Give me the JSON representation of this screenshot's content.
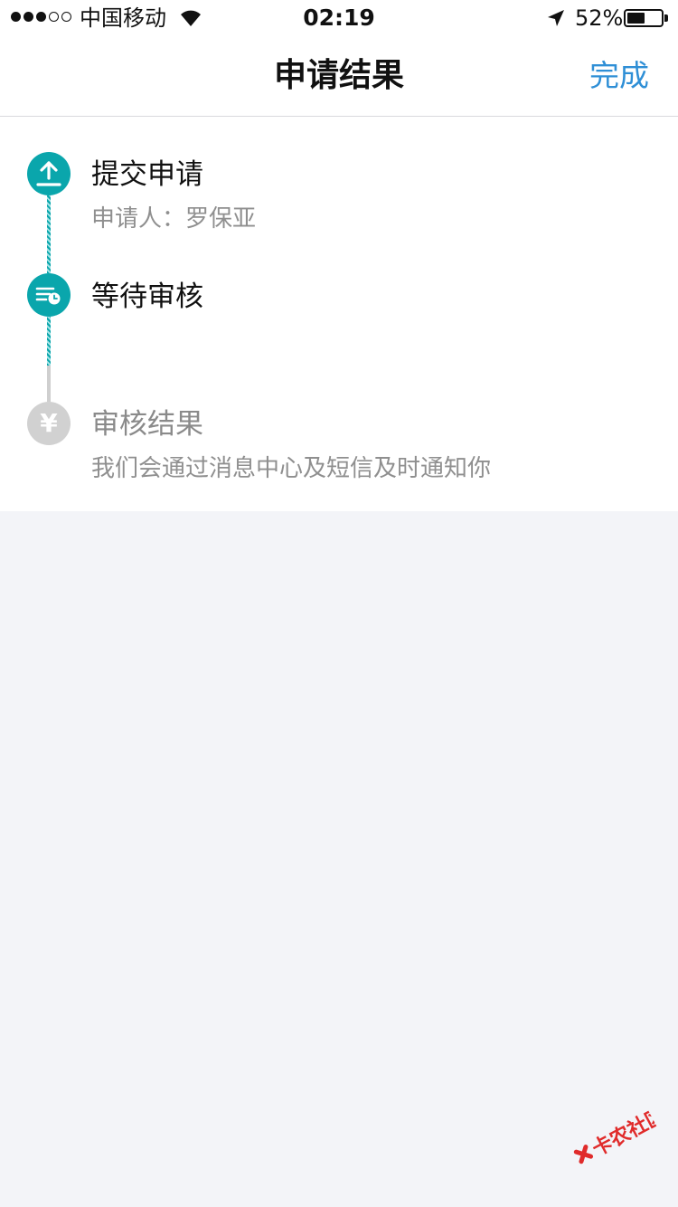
{
  "status_bar": {
    "carrier": "中国移动",
    "time": "02:19",
    "battery_percent_text": "52%",
    "battery_level": 0.52,
    "signal_strength": 3,
    "signal_max": 5,
    "icons": [
      "wifi-icon",
      "location-arrow-icon",
      "battery-icon"
    ]
  },
  "nav": {
    "title": "申请结果",
    "done_label": "完成"
  },
  "timeline": {
    "steps": [
      {
        "title": "提交申请",
        "subtitle": "申请人：罗保亚",
        "state": "done",
        "icon": "upload-icon"
      },
      {
        "title": "等待审核",
        "subtitle": "",
        "state": "current",
        "icon": "review-clock-icon"
      },
      {
        "title": "审核结果",
        "subtitle": "我们会通过消息中心及短信及时通知你",
        "state": "pending",
        "icon": "yen-icon",
        "icon_glyph": "¥"
      }
    ]
  },
  "colors": {
    "accent": "#0aa6ac",
    "link": "#2f8fd6",
    "pending": "#d1d1d1",
    "background": "#f3f4f8",
    "watermark_red": "#e02b2b"
  },
  "watermark": {
    "text": "卡农社区"
  }
}
